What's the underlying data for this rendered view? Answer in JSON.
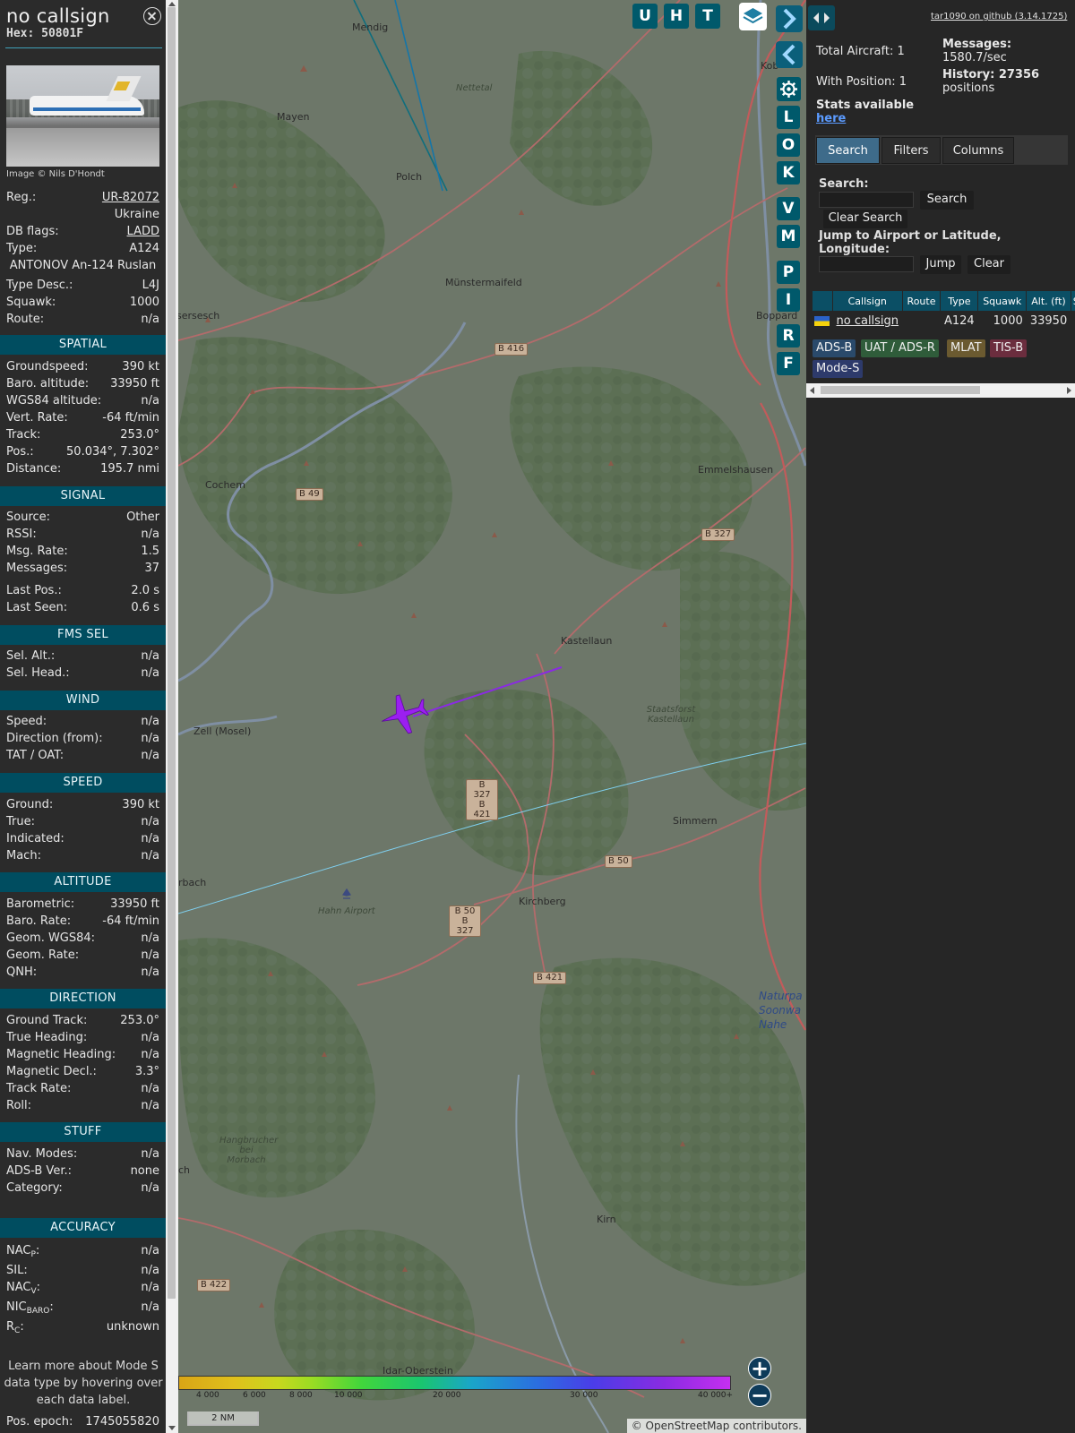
{
  "info": {
    "callsign": "no callsign",
    "hex": "Hex: 50801F",
    "photo_credit": "Image © Nils D'Hondt",
    "rows": [
      {
        "k": "Reg.:",
        "v": "UR-82072"
      },
      {
        "k": "",
        "v": "Ukraine"
      },
      {
        "k": "DB flags:",
        "v": "LADD"
      },
      {
        "k": "Type:",
        "v": "A124"
      },
      {
        "k": "",
        "v": "ANTONOV An-124 Ruslan"
      },
      {
        "k": "Type Desc.:",
        "v": "L4J"
      },
      {
        "k": "Squawk:",
        "v": "1000"
      },
      {
        "k": "Route:",
        "v": "n/a"
      }
    ],
    "sections": {
      "spatial": {
        "title": "SPATIAL",
        "rows": [
          {
            "k": "Groundspeed:",
            "v": "390 kt"
          },
          {
            "k": "Baro. altitude:",
            "v": "33950 ft"
          },
          {
            "k": "WGS84 altitude:",
            "v": "n/a"
          },
          {
            "k": "Vert. Rate:",
            "v": "-64 ft/min"
          },
          {
            "k": "Track:",
            "v": "253.0°"
          },
          {
            "k": "Pos.:",
            "v": "50.034°, 7.302°"
          },
          {
            "k": "Distance:",
            "v": "195.7 nmi"
          }
        ]
      },
      "signal": {
        "title": "SIGNAL",
        "rows": [
          {
            "k": "Source:",
            "v": "Other"
          },
          {
            "k": "RSSI:",
            "v": "n/a"
          },
          {
            "k": "Msg. Rate:",
            "v": "1.5"
          },
          {
            "k": "Messages:",
            "v": "37"
          },
          {
            "k": "Last Pos.:",
            "v": "2.0 s"
          },
          {
            "k": "Last Seen:",
            "v": "0.6 s"
          }
        ]
      },
      "fms": {
        "title": "FMS SEL",
        "rows": [
          {
            "k": "Sel. Alt.:",
            "v": "n/a"
          },
          {
            "k": "Sel. Head.:",
            "v": "n/a"
          }
        ]
      },
      "wind": {
        "title": "WIND",
        "rows": [
          {
            "k": "Speed:",
            "v": "n/a"
          },
          {
            "k": "Direction (from):",
            "v": "n/a"
          },
          {
            "k": "TAT / OAT:",
            "v": "n/a"
          }
        ]
      },
      "speed": {
        "title": "SPEED",
        "rows": [
          {
            "k": "Ground:",
            "v": "390 kt"
          },
          {
            "k": "True:",
            "v": "n/a"
          },
          {
            "k": "Indicated:",
            "v": "n/a"
          },
          {
            "k": "Mach:",
            "v": "n/a"
          }
        ]
      },
      "altitude": {
        "title": "ALTITUDE",
        "rows": [
          {
            "k": "Barometric:",
            "v": "33950 ft"
          },
          {
            "k": "Baro. Rate:",
            "v": "-64 ft/min"
          },
          {
            "k": "Geom. WGS84:",
            "v": "n/a"
          },
          {
            "k": "Geom. Rate:",
            "v": "n/a"
          },
          {
            "k": "QNH:",
            "v": "n/a"
          }
        ]
      },
      "direction": {
        "title": "DIRECTION",
        "rows": [
          {
            "k": "Ground Track:",
            "v": "253.0°"
          },
          {
            "k": "True Heading:",
            "v": "n/a"
          },
          {
            "k": "Magnetic Heading:",
            "v": "n/a"
          },
          {
            "k": "Magnetic Decl.:",
            "v": "3.3°"
          },
          {
            "k": "Track Rate:",
            "v": "n/a"
          },
          {
            "k": "Roll:",
            "v": "n/a"
          }
        ]
      },
      "stuff": {
        "title": "STUFF",
        "rows": [
          {
            "k": "Nav. Modes:",
            "v": "n/a"
          },
          {
            "k": "ADS-B Ver.:",
            "v": "none"
          },
          {
            "k": "Category:",
            "v": "n/a"
          }
        ]
      },
      "accuracy": {
        "title": "ACCURACY",
        "rows": [
          {
            "k": "NAC",
            "sub": "P",
            "v": "n/a"
          },
          {
            "k": "SIL:",
            "v": "n/a"
          },
          {
            "k": "NAC",
            "sub": "V",
            "v": "n/a"
          },
          {
            "k": "NIC",
            "sub": "BARO",
            "v": "n/a"
          },
          {
            "k": "R",
            "sub": "C",
            "v": "unknown"
          }
        ]
      }
    },
    "learn_more": "Learn more about Mode S data type by hovering over each data label.",
    "pos_epoch_label": "Pos. epoch:",
    "pos_epoch_value": "1745055820"
  },
  "map": {
    "buttons": {
      "u": "U",
      "h": "H",
      "t": "T",
      "l": "L",
      "o": "O",
      "k": "K",
      "v": "V",
      "m": "M",
      "p": "P",
      "i": "I",
      "r": "R",
      "f": "F"
    },
    "towns": {
      "mendig": "Mendig",
      "mayen": "Mayen",
      "polch": "Polch",
      "nettetal": "Nettetal",
      "muenstermaifeld": "Münstermaifeld",
      "koblenz": "Kob",
      "boppard": "Boppard",
      "cochem": "Cochem",
      "emmelshausen": "Emmelshausen",
      "kastellaun": "Kastellaun",
      "staatsforst": "Staatsforst Kastellaun",
      "zell": "Zell (Mosel)",
      "simmern": "Simmern",
      "kirchberg": "Kirchberg",
      "hahn": "Hahn Airport",
      "rbach": "rbach",
      "naturpa": "Naturpa Soonwa Nahe",
      "hangbrucher": "Hangbrucher bei Morbach",
      "kirn": "Kirn",
      "idar": "Idar-Oberstein",
      "ch": "ch",
      "sersesch": "sersesch"
    },
    "roads": {
      "b416": "B 416",
      "b49": "B 49",
      "b327a": "B 327",
      "b327b421": "B 327 B 421",
      "b50": "B 50",
      "b50b327": "B 50 B 327",
      "b421": "B 421",
      "b422": "B 422"
    },
    "legend": [
      "4 000",
      "6 000",
      "8 000",
      "10 000",
      "20 000",
      "30 000",
      "40 000+"
    ],
    "scale": "2 NM",
    "attribution": "© OpenStreetMap contributors."
  },
  "sidebar": {
    "github": "tar1090 on github (3.14.1725)",
    "total_aircraft": "Total Aircraft: 1",
    "with_position": "With Position: 1",
    "stats_available": "Stats available",
    "here": "here",
    "messages_label": "Messages:",
    "messages_value": "1580.7/sec",
    "history_label": "History: 27356",
    "history_value": "positions",
    "tabs": [
      "Search",
      "Filters",
      "Columns"
    ],
    "search_label": "Search:",
    "search_button": "Search",
    "clear_search_button": "Clear Search",
    "jump_label": "Jump to Airport or Latitude, Longitude:",
    "jump_button": "Jump",
    "clear_button": "Clear",
    "table": {
      "headers": [
        "",
        "Callsign",
        "Route",
        "Type",
        "Squawk",
        "Alt. (ft)",
        "S"
      ],
      "rows": [
        {
          "callsign": "no callsign",
          "route": "",
          "type": "A124",
          "squawk": "1000",
          "alt": "33950"
        }
      ]
    },
    "chips": [
      {
        "label": "ADS-B",
        "color": "#2a4a6b"
      },
      {
        "label": "UAT / ADS-R",
        "color": "#2f5c3a"
      },
      {
        "label": "MLAT",
        "color": "#6b5a30"
      },
      {
        "label": "TIS-B",
        "color": "#6b2d3e"
      },
      {
        "label": "Mode-S",
        "color": "#2d3a6b"
      }
    ]
  }
}
